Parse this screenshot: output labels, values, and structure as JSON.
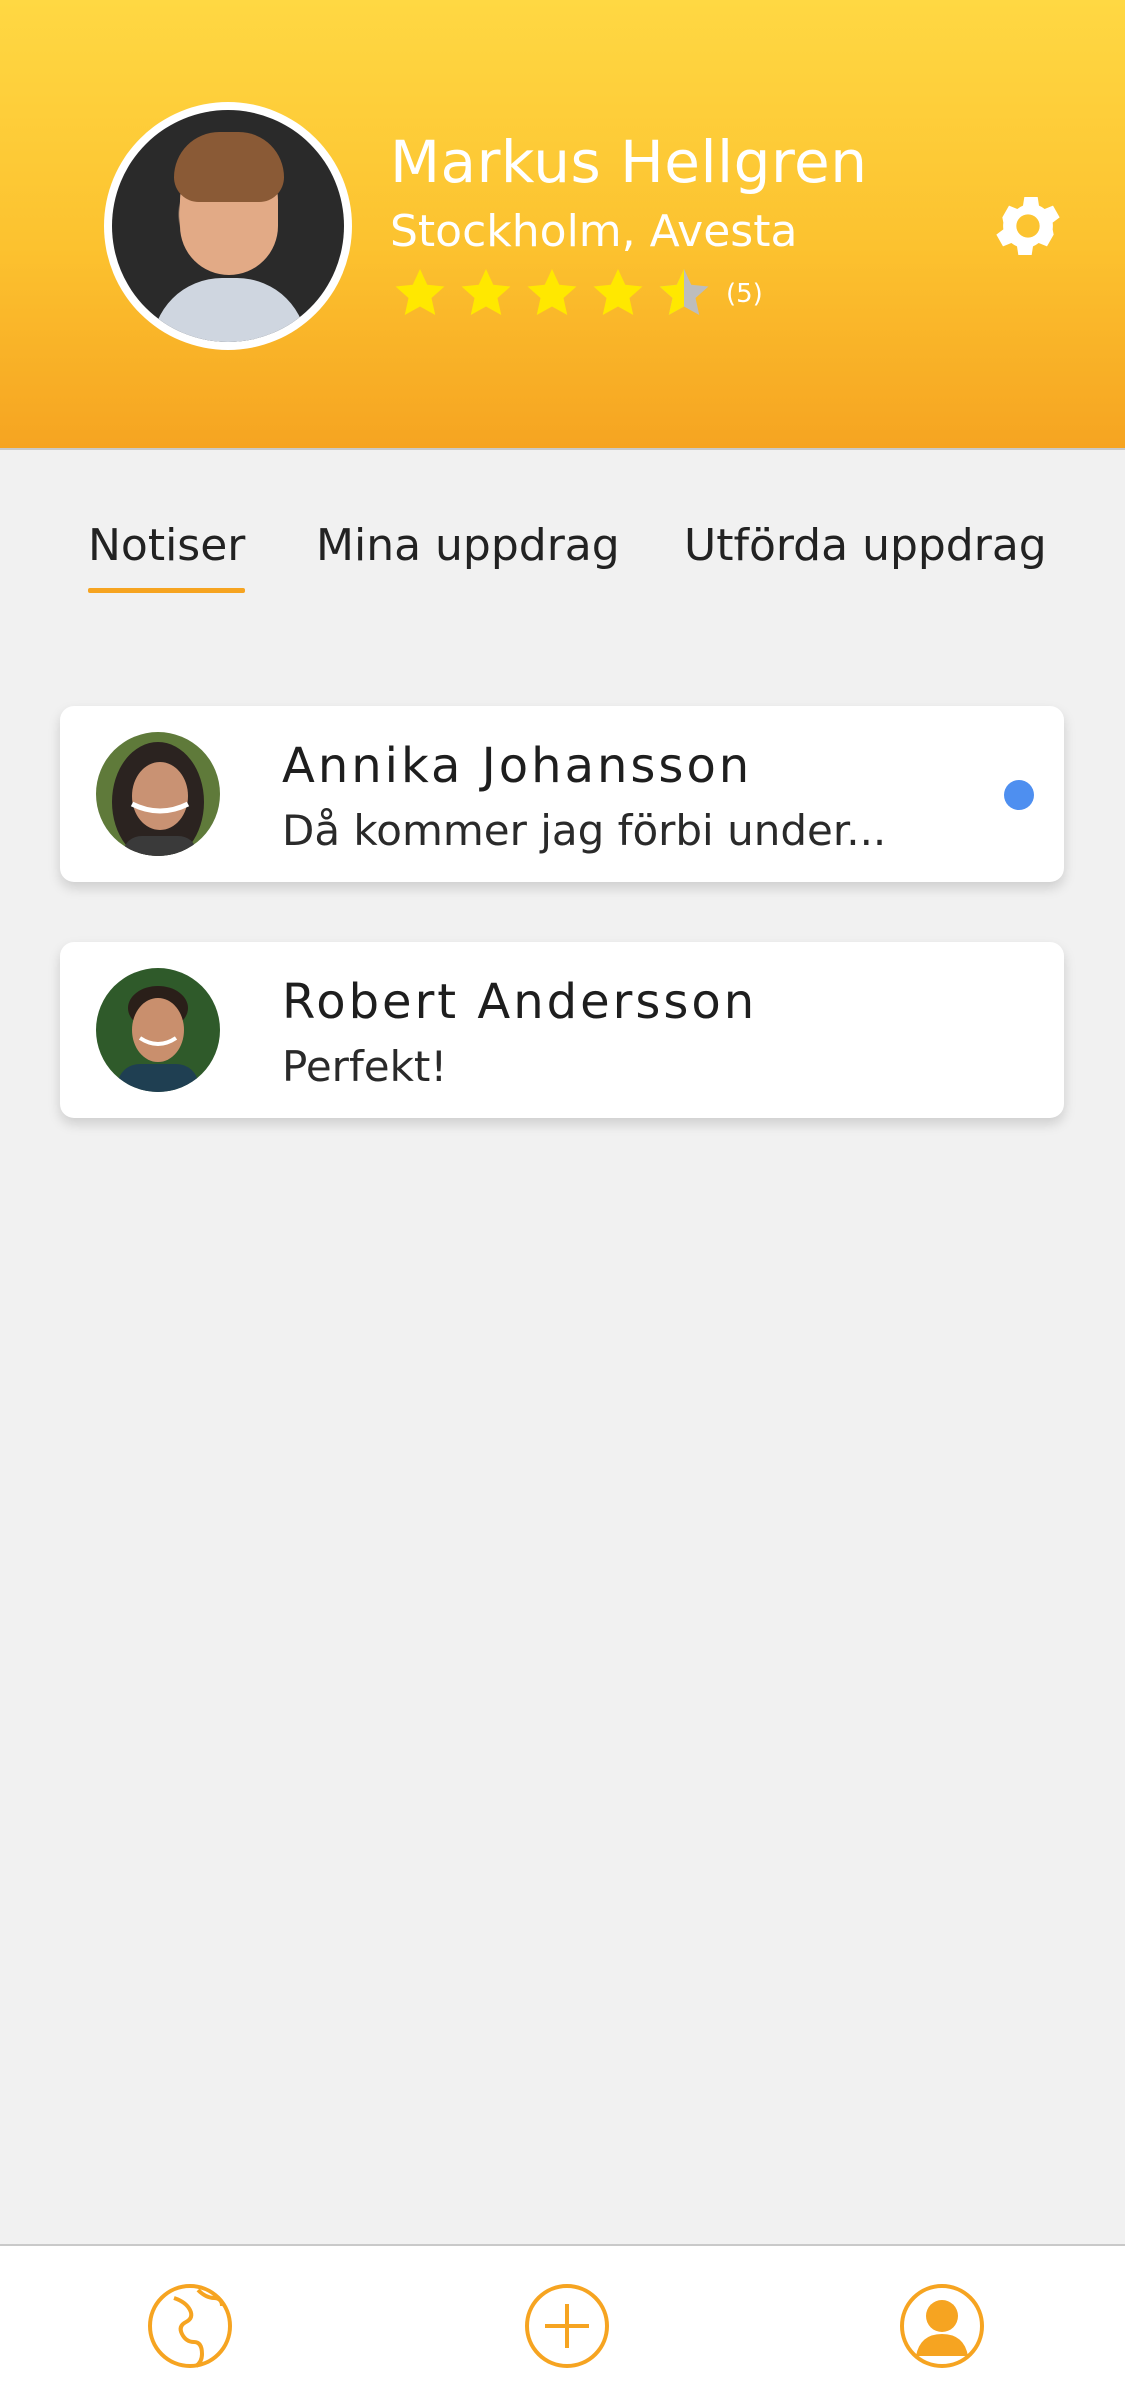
{
  "profile": {
    "name": "Markus Hellgren",
    "location": "Stockholm, Avesta",
    "rating_stars": 4.5,
    "rating_count": "(5)"
  },
  "colors": {
    "accent": "#f6a421",
    "star": "#ffe800",
    "star_empty": "#bdbdbd",
    "unread": "#4e8ff0"
  },
  "tabs": [
    {
      "label": "Notiser",
      "active": true
    },
    {
      "label": "Mina uppdrag",
      "active": false
    },
    {
      "label": "Utförda uppdrag",
      "active": false
    }
  ],
  "notifications": [
    {
      "name": "Annika Johansson",
      "message": "Då kommer jag förbi under...",
      "unread": true
    },
    {
      "name": "Robert Andersson",
      "message": "Perfekt!",
      "unread": false
    }
  ],
  "icons": {
    "settings": "gear-icon",
    "nav_explore": "globe-icon",
    "nav_add": "plus-circle-icon",
    "nav_profile": "user-icon"
  }
}
